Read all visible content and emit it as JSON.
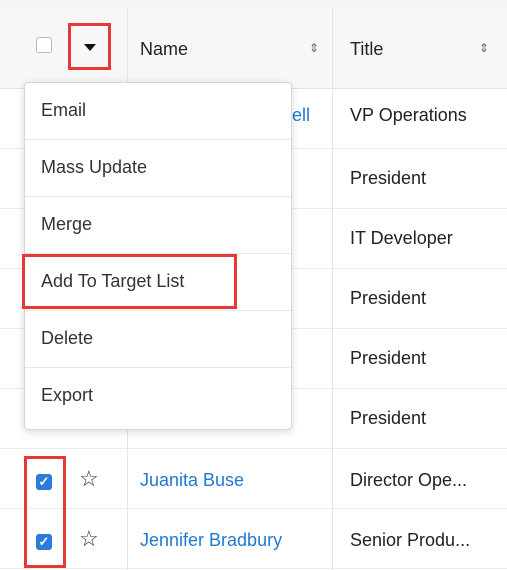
{
  "header": {
    "name_label": "Name",
    "title_label": "Title"
  },
  "rows": [
    {
      "name_partial": "ell",
      "title": "VP Operations"
    },
    {
      "title": "President"
    },
    {
      "title": "IT Developer"
    },
    {
      "title": "President"
    },
    {
      "title": "President"
    },
    {
      "title": "President"
    },
    {
      "name": "Juanita Buse",
      "title": "Director Ope...",
      "checked": true
    },
    {
      "name": "Jennifer Bradbury",
      "title": "Senior Produ...",
      "checked": true
    }
  ],
  "menu": {
    "items": [
      "Email",
      "Mass Update",
      "Merge",
      "Add To Target List",
      "Delete",
      "Export"
    ]
  },
  "colors": {
    "accent": "#2a7cd7",
    "link": "#1f78d1",
    "highlight": "#e53935"
  },
  "icons": {
    "sort": "sort-icon",
    "star": "star-icon",
    "caret": "caret-down-icon"
  }
}
